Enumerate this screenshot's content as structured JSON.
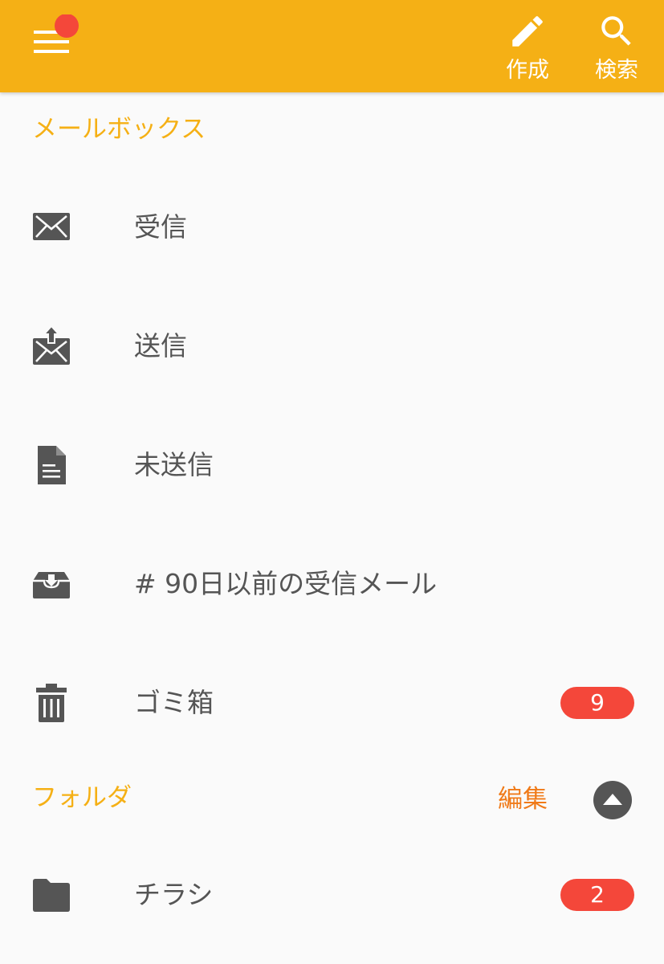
{
  "header": {
    "compose_label": "作成",
    "search_label": "検索",
    "background_color": "#f5b015",
    "notification_dot_color": "#f4473a"
  },
  "mailboxes": {
    "title": "メールボックス",
    "items": [
      {
        "label": "受信",
        "icon": "envelope-icon"
      },
      {
        "label": "送信",
        "icon": "outbox-icon"
      },
      {
        "label": "未送信",
        "icon": "draft-document-icon"
      },
      {
        "label": "# 90日以前の受信メール",
        "icon": "archive-tray-icon"
      },
      {
        "label": "ゴミ箱",
        "icon": "trash-icon",
        "badge": "9"
      }
    ]
  },
  "folders": {
    "title": "フォルダ",
    "edit_label": "編集",
    "collapse_icon": "collapse-up-icon",
    "items": [
      {
        "label": "チラシ",
        "icon": "folder-icon",
        "badge": "2"
      }
    ]
  },
  "colors": {
    "accent": "#f5b015",
    "edit": "#f07a18",
    "badge": "#f4473a",
    "icon": "#555555",
    "text": "#555555",
    "background": "#fafafa"
  }
}
